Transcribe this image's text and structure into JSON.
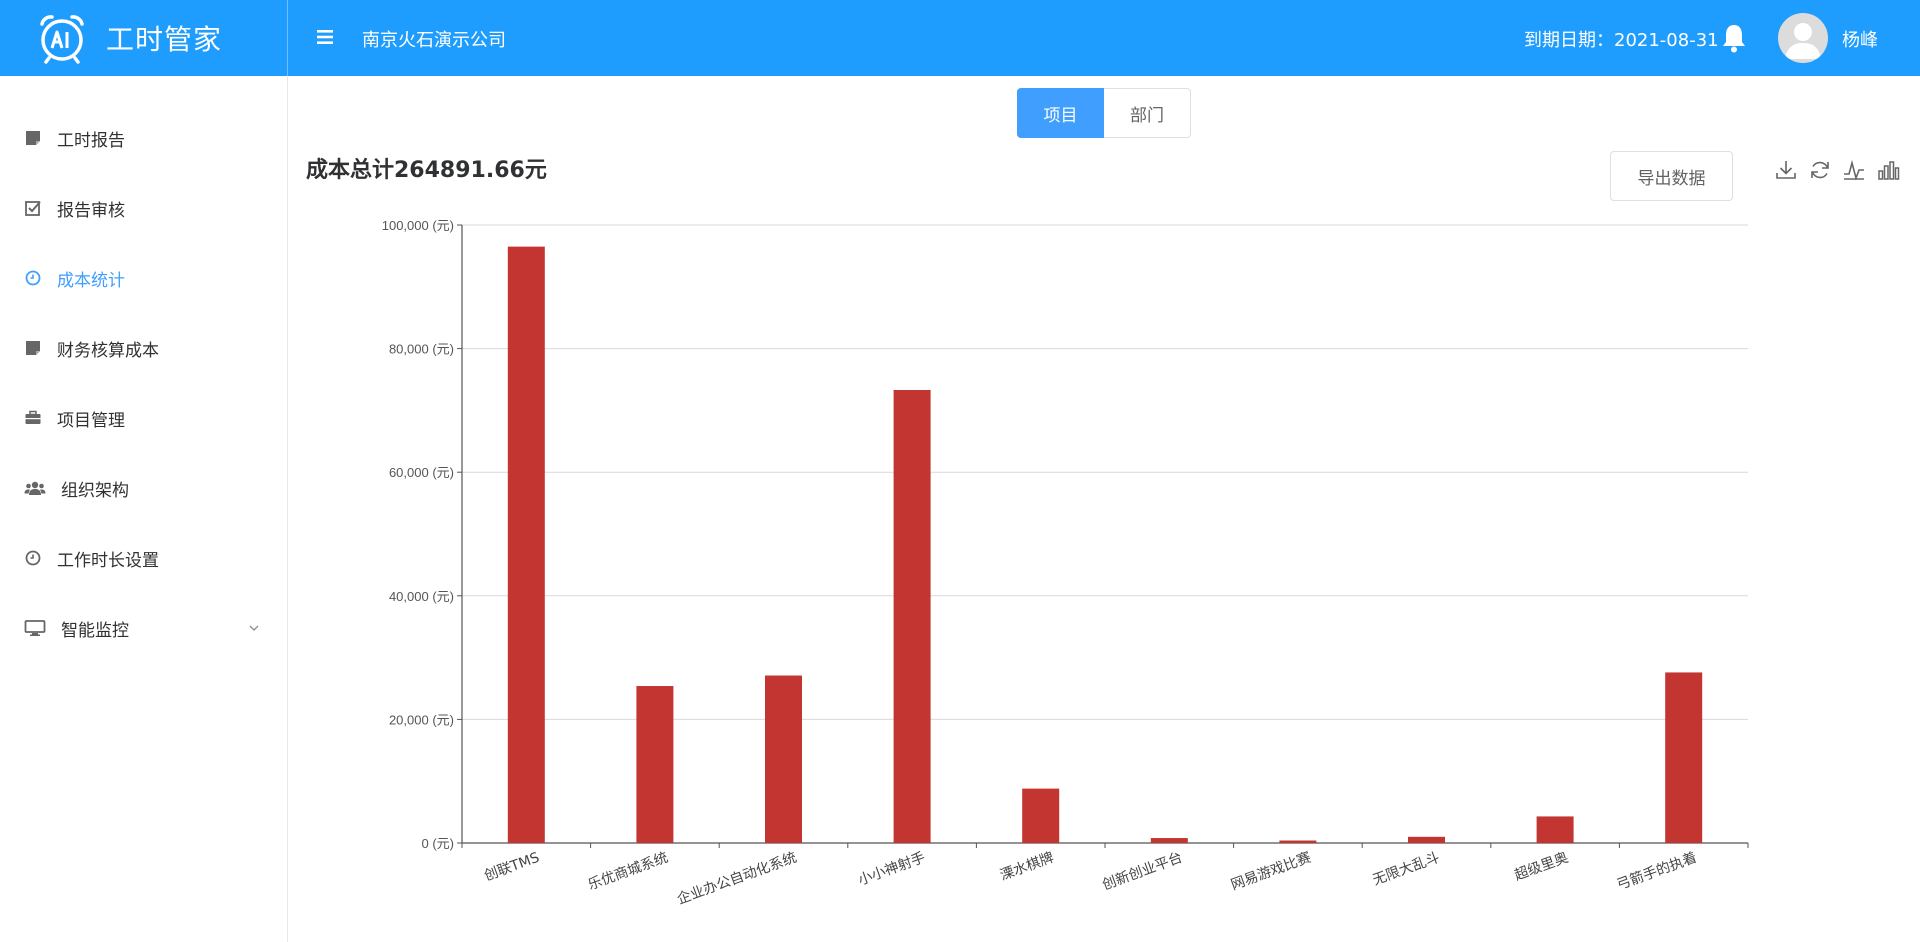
{
  "header": {
    "app_name": "工时管家",
    "company": "南京火石演示公司",
    "expiry": "到期日期：2021-08-31",
    "username": "杨峰"
  },
  "sidebar": {
    "items": [
      {
        "label": "工时报告",
        "icon": "document-icon"
      },
      {
        "label": "报告审核",
        "icon": "check-square-icon"
      },
      {
        "label": "成本统计",
        "icon": "clock-icon",
        "active": true
      },
      {
        "label": "财务核算成本",
        "icon": "document-icon"
      },
      {
        "label": "项目管理",
        "icon": "briefcase-icon"
      },
      {
        "label": "组织架构",
        "icon": "users-icon"
      },
      {
        "label": "工作时长设置",
        "icon": "clock-icon"
      },
      {
        "label": "智能监控",
        "icon": "monitor-icon",
        "has_submenu": true
      }
    ]
  },
  "tabs": {
    "project": "项目",
    "department": "部门"
  },
  "cost_total": "成本总计264891.66元",
  "export_label": "导出数据",
  "toolbox": [
    "download-icon",
    "refresh-icon",
    "line-chart-icon",
    "bar-chart-icon"
  ],
  "colors": {
    "header": "#1f9dfe",
    "accent": "#409eff",
    "bar": "#c23531"
  },
  "chart_data": {
    "type": "bar",
    "categories": [
      "创联TMS",
      "乐优商城系统",
      "企业办公自动化系统",
      "小小神射手",
      "溧水棋牌",
      "创新创业平台",
      "网易游戏比赛",
      "无限大乱斗",
      "超级里奥",
      "弓箭手的执着"
    ],
    "values": [
      96500,
      25400,
      27100,
      73300,
      8800,
      800,
      400,
      1000,
      4300,
      27600
    ],
    "yticks": [
      "0 (元)",
      "20,000 (元)",
      "40,000 (元)",
      "60,000 (元)",
      "80,000 (元)",
      "100,000 (元)"
    ],
    "ylim": [
      0,
      100000
    ],
    "grid": true
  }
}
